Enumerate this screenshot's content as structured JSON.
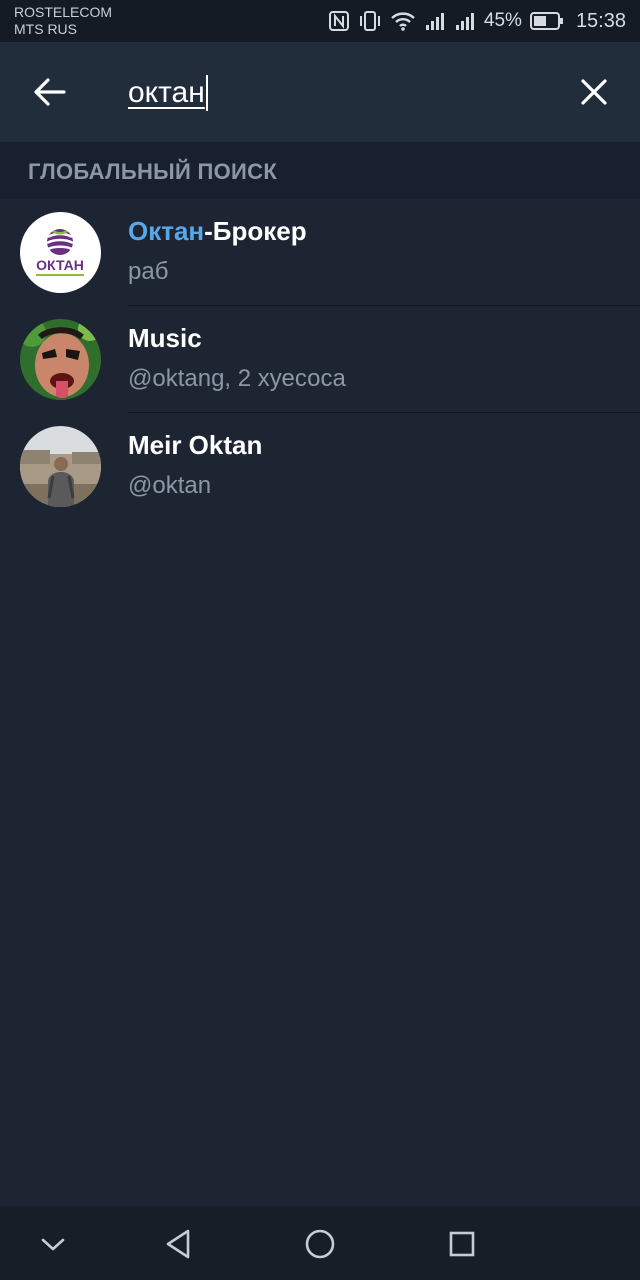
{
  "status_bar": {
    "carrier_1": "ROSTELECOM",
    "carrier_2": "MTS RUS",
    "battery": "45%",
    "time": "15:38",
    "icons": [
      "nfc-icon",
      "vibrate-icon",
      "wifi-icon",
      "signal-icon",
      "signal-icon",
      "battery-icon"
    ]
  },
  "search": {
    "query": "октан"
  },
  "section": {
    "title": "ГЛОБАЛЬНЫЙ ПОИСК"
  },
  "results": [
    {
      "name_highlight": "Октан",
      "name_rest": "-Брокер",
      "subtitle": "раб"
    },
    {
      "name_highlight": "",
      "name_rest": "Music",
      "subtitle": "@oktang, 2 хуесоса"
    },
    {
      "name_highlight": "",
      "name_rest": "Meir Oktan",
      "subtitle": "@oktan"
    }
  ],
  "avatar_logo_text": "ОКТАН",
  "colors": {
    "background": "#1d2532",
    "header": "#222d3c",
    "section_header": "#182030",
    "highlight": "#5aa7e6",
    "secondary_text": "#8b97a5"
  }
}
